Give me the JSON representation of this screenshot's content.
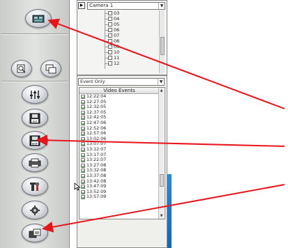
{
  "camera_panel": {
    "selected_camera": "Camera 1",
    "play_glyph": "▶",
    "items": [
      "03",
      "04",
      "05",
      "06",
      "07",
      "08",
      "09",
      "10",
      "11",
      "12"
    ]
  },
  "event_panel": {
    "filter": "Event Only",
    "list_header": "Video Events",
    "events": [
      "12:22:04",
      "12:27:05",
      "12:32:05",
      "12:37:05",
      "12:42:05",
      "12:47:06",
      "12:52:06",
      "12:57:06",
      "13:02:06",
      "13:07:07",
      "13:12:07",
      "13:17:07",
      "13:22:07",
      "13:27:08",
      "13:32:08",
      "13:37:08",
      "13:42:08",
      "13:47:09",
      "13:52:09",
      "13:57:09"
    ]
  },
  "toolbar": {
    "buttons": [
      "camera-view-icon",
      "zoom-search-icon",
      "multi-window-icon",
      "settings-sliders-icon",
      "save-avi-icon",
      "save-bmp-icon",
      "print-icon",
      "tools-icon",
      "config-gear-icon",
      "export-icon"
    ]
  },
  "colors": {
    "arrow": "#e8141b",
    "desktop_blue": "#2d8fde",
    "toolbar_grey": "#d6d8d6"
  }
}
